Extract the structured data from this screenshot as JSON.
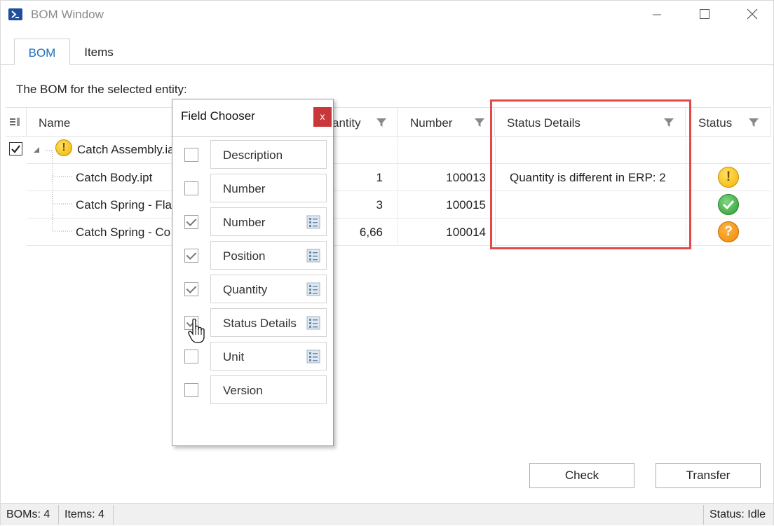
{
  "window": {
    "title": "BOM Window"
  },
  "tabs": [
    {
      "label": "BOM",
      "selected": true
    },
    {
      "label": "Items",
      "selected": false
    }
  ],
  "caption": "The BOM for the selected entity:",
  "grid": {
    "columns": {
      "name": "Name",
      "quantity": "antity",
      "number": "Number",
      "status_details": "Status Details",
      "status": "Status"
    },
    "rows": [
      {
        "name": "Catch Assembly.ia",
        "quantity": "",
        "number": "",
        "status_details": "",
        "status": "warning",
        "expanded": true,
        "checked": true
      },
      {
        "name": "Catch Body.ipt",
        "quantity": "1",
        "number": "100013",
        "status_details": "Quantity is different in ERP: 2",
        "status": "warning"
      },
      {
        "name": "Catch Spring - Fla",
        "quantity": "3",
        "number": "100015",
        "status_details": "",
        "status": "ok"
      },
      {
        "name": "Catch Spring - Co",
        "quantity": "6,66",
        "number": "100014",
        "status_details": "",
        "status": "unknown"
      }
    ]
  },
  "field_chooser": {
    "title": "Field Chooser",
    "close_label": "x",
    "fields": [
      {
        "label": "Description",
        "checked": false,
        "has_icon": false
      },
      {
        "label": "Number",
        "checked": false,
        "has_icon": false
      },
      {
        "label": "Number",
        "checked": true,
        "has_icon": true
      },
      {
        "label": "Position",
        "checked": true,
        "has_icon": true
      },
      {
        "label": "Quantity",
        "checked": true,
        "has_icon": true
      },
      {
        "label": "Status Details",
        "checked": true,
        "has_icon": true
      },
      {
        "label": "Unit",
        "checked": false,
        "has_icon": true
      },
      {
        "label": "Version",
        "checked": false,
        "has_icon": false
      }
    ]
  },
  "buttons": {
    "check": "Check",
    "transfer": "Transfer"
  },
  "statusbar": {
    "boms": "BOMs: 4",
    "items": "Items: 4",
    "status": "Status: Idle"
  },
  "colors": {
    "accent": "#1e6fc0",
    "highlight": "#e24a4a",
    "close_red": "#c8383a"
  }
}
